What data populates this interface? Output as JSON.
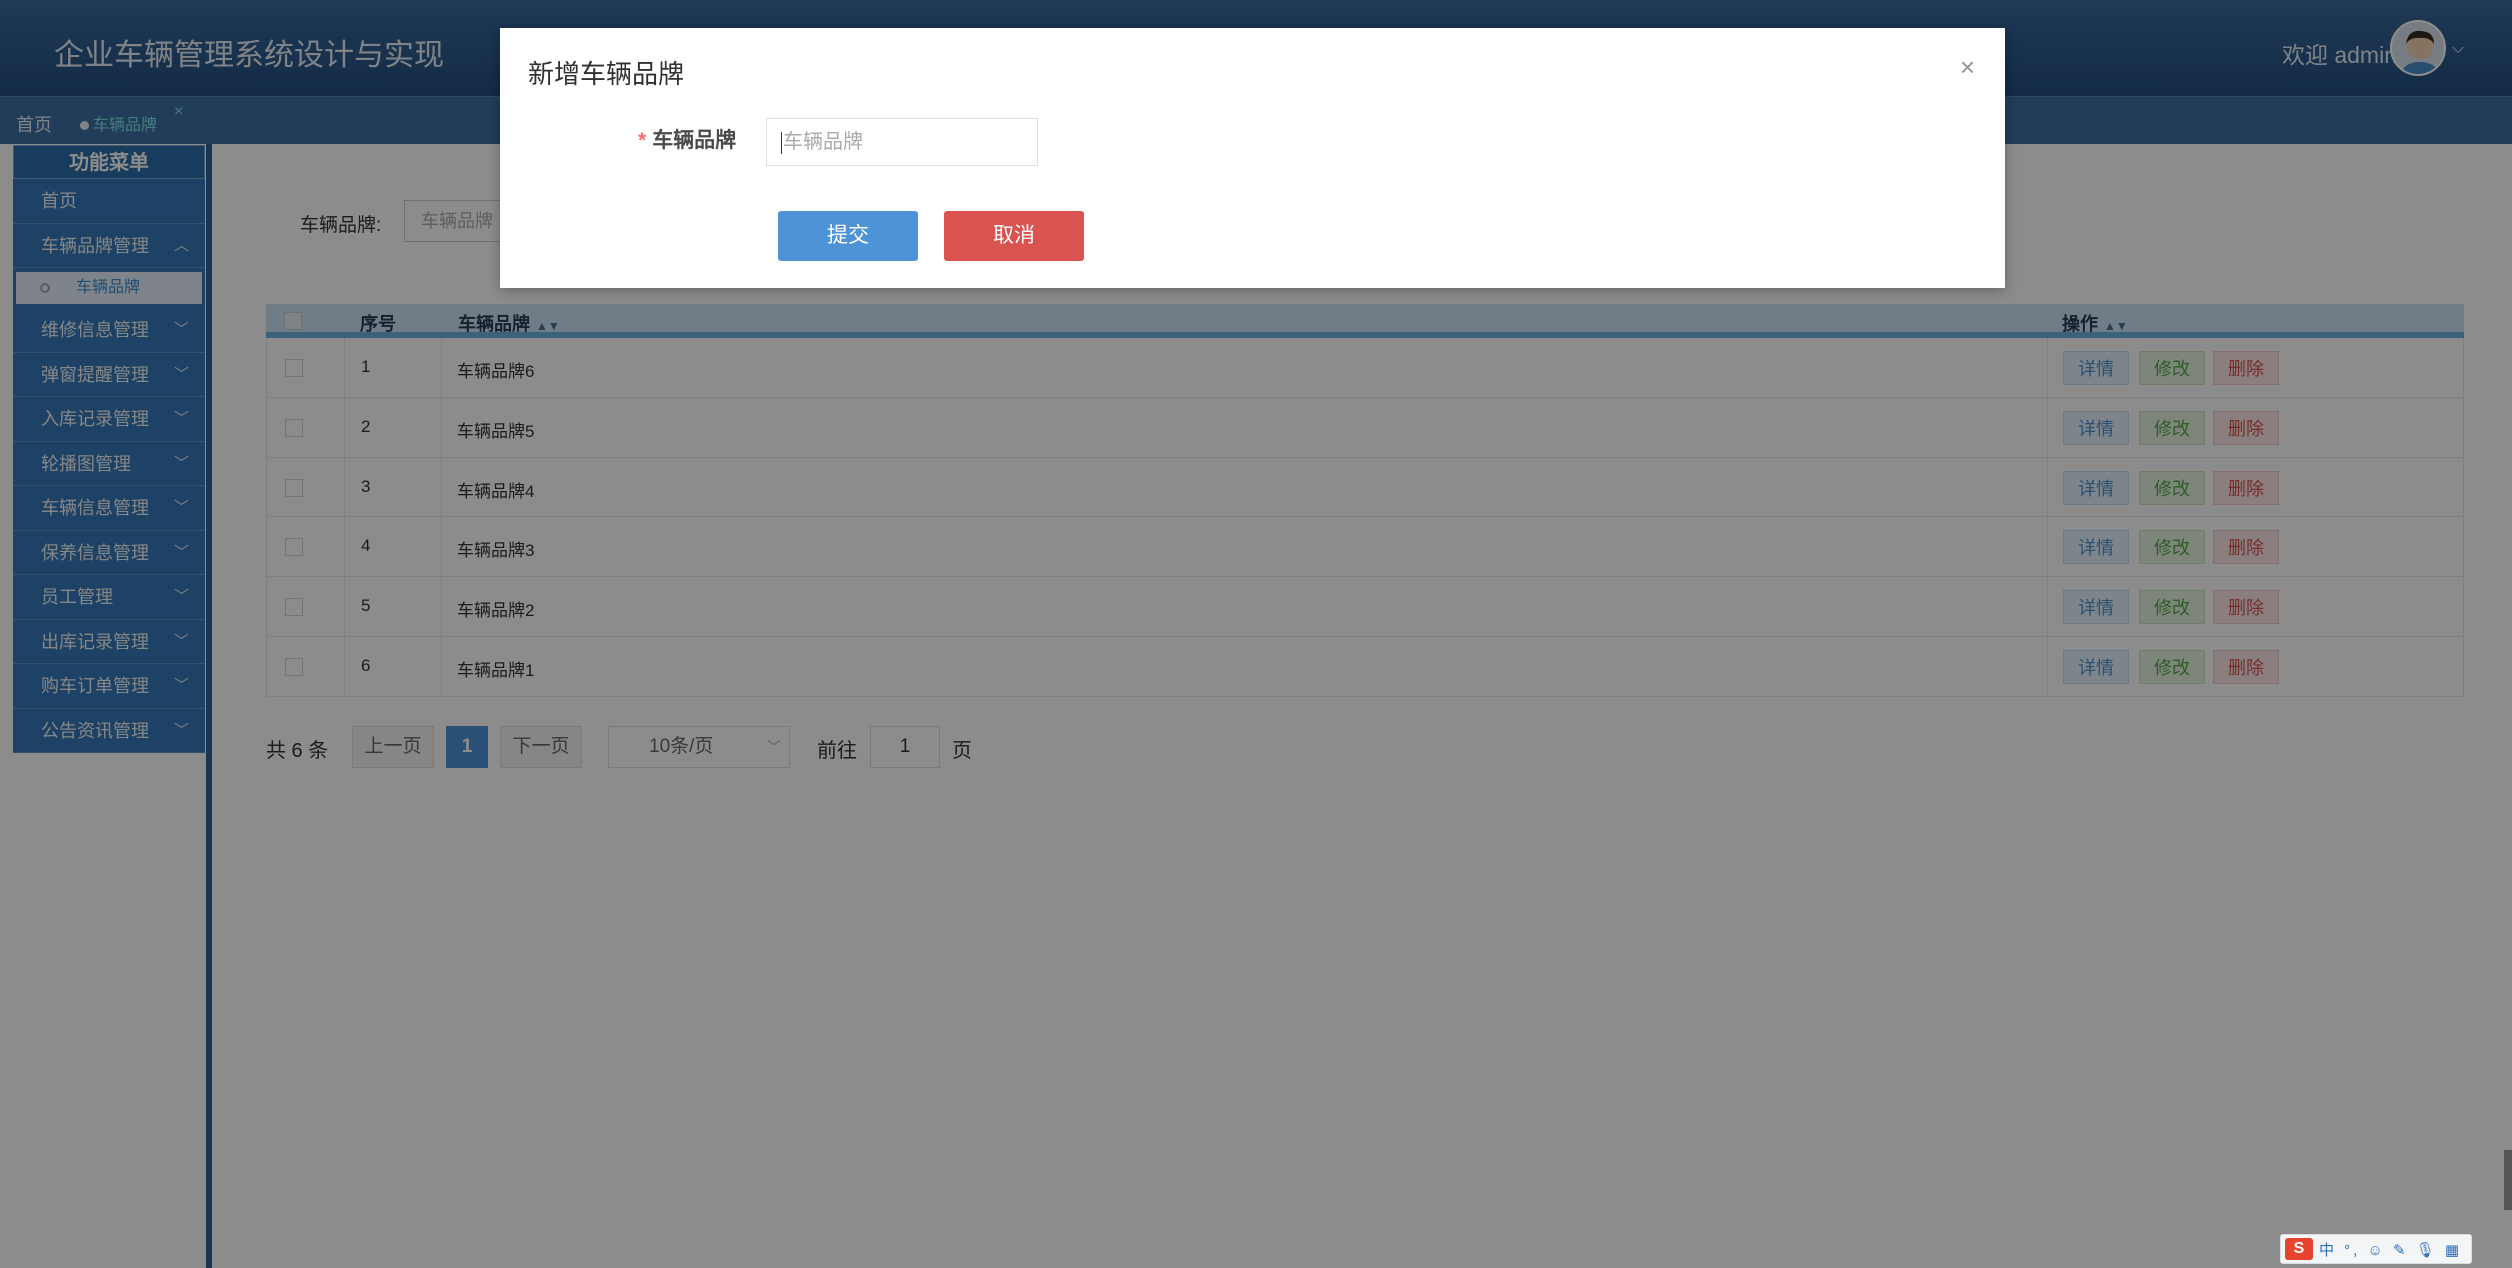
{
  "header": {
    "title": "企业车辆管理系统设计与实现",
    "welcome": "欢迎 admin"
  },
  "tabs": {
    "home": "首页",
    "active": "车辆品牌",
    "close": "×"
  },
  "sidebar": {
    "heading": "功能菜单",
    "home": "首页",
    "brand_mgmt": "车辆品牌管理",
    "brand_sub": "车辆品牌",
    "items": [
      "维修信息管理",
      "弹窗提醒管理",
      "入库记录管理",
      "轮播图管理",
      "车辆信息管理",
      "保养信息管理",
      "员工管理",
      "出库记录管理",
      "购车订单管理",
      "公告资讯管理"
    ]
  },
  "search": {
    "label": "车辆品牌:",
    "placeholder": "车辆品牌"
  },
  "table": {
    "headers": {
      "index": "序号",
      "brand": "车辆品牌",
      "actions": "操作"
    },
    "rows": [
      {
        "index": "1",
        "brand": "车辆品牌6"
      },
      {
        "index": "2",
        "brand": "车辆品牌5"
      },
      {
        "index": "3",
        "brand": "车辆品牌4"
      },
      {
        "index": "4",
        "brand": "车辆品牌3"
      },
      {
        "index": "5",
        "brand": "车辆品牌2"
      },
      {
        "index": "6",
        "brand": "车辆品牌1"
      }
    ],
    "actions": {
      "detail": "详情",
      "edit": "修改",
      "delete": "删除"
    }
  },
  "pagination": {
    "total": "共 6 条",
    "prev": "上一页",
    "current": "1",
    "next": "下一页",
    "page_size": "10条/页",
    "goto": "前往",
    "goto_value": "1",
    "page_suffix": "页"
  },
  "modal": {
    "title": "新增车辆品牌",
    "close": "×",
    "field_label": "车辆品牌",
    "required_mark": "*",
    "field_placeholder": "车辆品牌",
    "submit": "提交",
    "cancel": "取消"
  },
  "ime": {
    "logo": "S",
    "icons": "中 °, ☺ ✎ 🎙 ▦"
  }
}
